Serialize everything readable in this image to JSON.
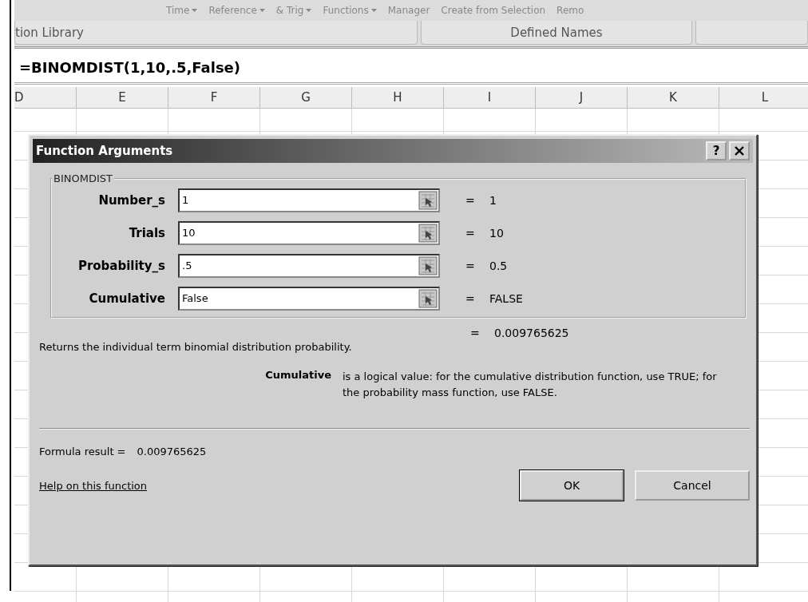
{
  "ribbon": {
    "buttons": [
      {
        "label": "Time",
        "menu": true
      },
      {
        "label": "Reference",
        "menu": true
      },
      {
        "label": "& Trig",
        "menu": true
      },
      {
        "label": "Functions",
        "menu": true
      },
      {
        "label": "Manager",
        "menu": false
      },
      {
        "label": "Create from Selection",
        "menu": false
      },
      {
        "label": "Remo",
        "menu": false
      }
    ],
    "groups": [
      "tion Library",
      "Defined Names"
    ]
  },
  "formula_bar": {
    "formula": "=BINOMDIST(1,10,.5,False)"
  },
  "columns": [
    "D",
    "E",
    "F",
    "G",
    "H",
    "I",
    "J",
    "K",
    "L"
  ],
  "dialog": {
    "title": "Function Arguments",
    "help_button": "?",
    "function_name": "BINOMDIST",
    "arguments": [
      {
        "label": "Number_s",
        "value": "1",
        "equals": "=",
        "result": "1"
      },
      {
        "label": "Trials",
        "value": "10",
        "equals": "=",
        "result": "10"
      },
      {
        "label": "Probability_s",
        "value": ".5",
        "equals": "=",
        "result": "0.5"
      },
      {
        "label": "Cumulative",
        "value": "False",
        "equals": "=",
        "result": "FALSE"
      }
    ],
    "result_equals": "=",
    "result": "0.009765625",
    "description": "Returns the individual term binomial distribution probability.",
    "argument_help": {
      "name": "Cumulative",
      "text": "is a logical value: for the cumulative distribution function, use TRUE; for the probability mass function, use FALSE."
    },
    "formula_result_label": "Formula result =",
    "formula_result": "0.009765625",
    "help_link": "Help on this function",
    "buttons": [
      {
        "label": "OK",
        "default": true
      },
      {
        "label": "Cancel",
        "default": false
      }
    ]
  }
}
